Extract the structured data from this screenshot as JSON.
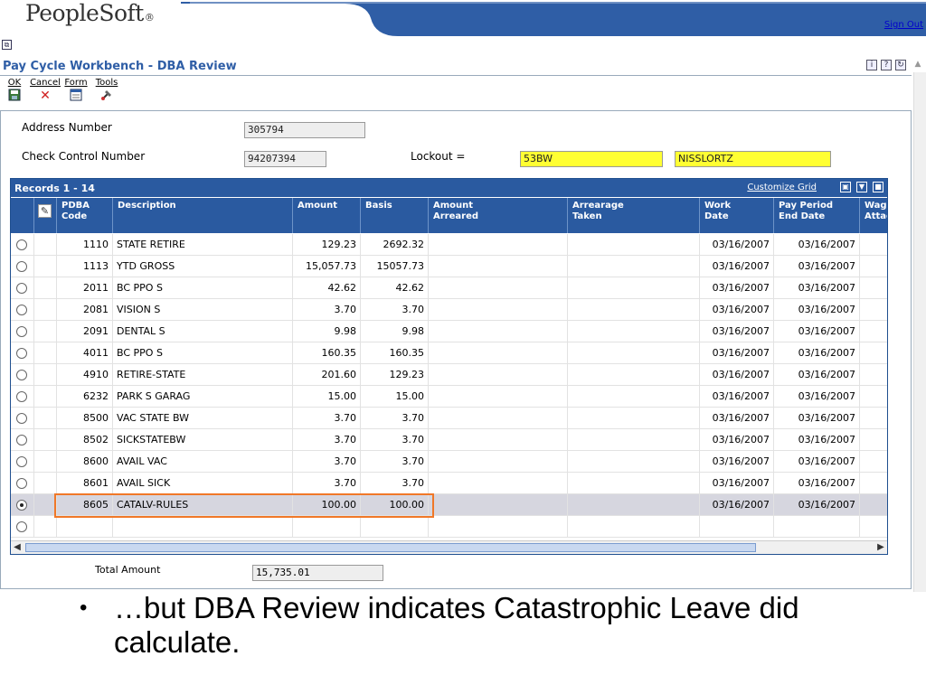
{
  "header": {
    "logo": "PeopleSoft",
    "logo_mark": "®",
    "sign_out": "Sign Out"
  },
  "form": {
    "title": "Pay Cycle Workbench - DBA Review"
  },
  "toolbar": {
    "items": [
      {
        "label": "OK",
        "icon": "save-icon"
      },
      {
        "label": "Cancel",
        "icon": "close-icon"
      },
      {
        "label": "Form",
        "icon": "form-icon"
      },
      {
        "label": "Tools",
        "icon": "tools-icon"
      }
    ]
  },
  "fields": {
    "address_number_label": "Address Number",
    "address_number_value": "305794",
    "check_control_label": "Check Control Number",
    "check_control_value": "94207394",
    "lockout_label": "Lockout =",
    "lockout_value1": "53BW",
    "lockout_value2": "NISSLORTZ"
  },
  "grid": {
    "records_label": "Records 1 - 14",
    "customize_label": "Customize Grid",
    "columns": [
      {
        "label": "PDBA\nCode"
      },
      {
        "label": "Description"
      },
      {
        "label": "Amount"
      },
      {
        "label": "Basis"
      },
      {
        "label": "Amount\nArreared"
      },
      {
        "label": "Arrearage\nTaken"
      },
      {
        "label": "Work\nDate"
      },
      {
        "label": "Pay Period\nEnd Date"
      },
      {
        "label": "Wage\nAttach"
      }
    ],
    "rows": [
      {
        "code": "1110",
        "desc": "STATE RETIRE",
        "amount": "129.23",
        "basis": "2692.32",
        "work": "03/16/2007",
        "ppend": "03/16/2007"
      },
      {
        "code": "1113",
        "desc": "YTD GROSS",
        "amount": "15,057.73",
        "basis": "15057.73",
        "work": "03/16/2007",
        "ppend": "03/16/2007"
      },
      {
        "code": "2011",
        "desc": "BC PPO S",
        "amount": "42.62",
        "basis": "42.62",
        "work": "03/16/2007",
        "ppend": "03/16/2007"
      },
      {
        "code": "2081",
        "desc": "VISION S",
        "amount": "3.70",
        "basis": "3.70",
        "work": "03/16/2007",
        "ppend": "03/16/2007"
      },
      {
        "code": "2091",
        "desc": "DENTAL S",
        "amount": "9.98",
        "basis": "9.98",
        "work": "03/16/2007",
        "ppend": "03/16/2007"
      },
      {
        "code": "4011",
        "desc": "BC PPO S",
        "amount": "160.35",
        "basis": "160.35",
        "work": "03/16/2007",
        "ppend": "03/16/2007"
      },
      {
        "code": "4910",
        "desc": "RETIRE-STATE",
        "amount": "201.60",
        "basis": "129.23",
        "work": "03/16/2007",
        "ppend": "03/16/2007"
      },
      {
        "code": "6232",
        "desc": "PARK S GARAG",
        "amount": "15.00",
        "basis": "15.00",
        "work": "03/16/2007",
        "ppend": "03/16/2007"
      },
      {
        "code": "8500",
        "desc": "VAC STATE BW",
        "amount": "3.70",
        "basis": "3.70",
        "work": "03/16/2007",
        "ppend": "03/16/2007"
      },
      {
        "code": "8502",
        "desc": "SICKSTATEBW",
        "amount": "3.70",
        "basis": "3.70",
        "work": "03/16/2007",
        "ppend": "03/16/2007"
      },
      {
        "code": "8600",
        "desc": "AVAIL VAC",
        "amount": "3.70",
        "basis": "3.70",
        "work": "03/16/2007",
        "ppend": "03/16/2007"
      },
      {
        "code": "8601",
        "desc": "AVAIL SICK",
        "amount": "3.70",
        "basis": "3.70",
        "work": "03/16/2007",
        "ppend": "03/16/2007"
      },
      {
        "code": "8605",
        "desc": "CATALV-RULES",
        "amount": "100.00",
        "basis": "100.00",
        "work": "03/16/2007",
        "ppend": "03/16/2007",
        "selected": true
      },
      {
        "code": "",
        "desc": "",
        "amount": "",
        "basis": "",
        "work": "",
        "ppend": ""
      }
    ]
  },
  "totals": {
    "label": "Total Amount",
    "value": "15,735.01"
  },
  "slide": {
    "bullet": "…but DBA Review indicates Catastrophic Leave did calculate."
  }
}
